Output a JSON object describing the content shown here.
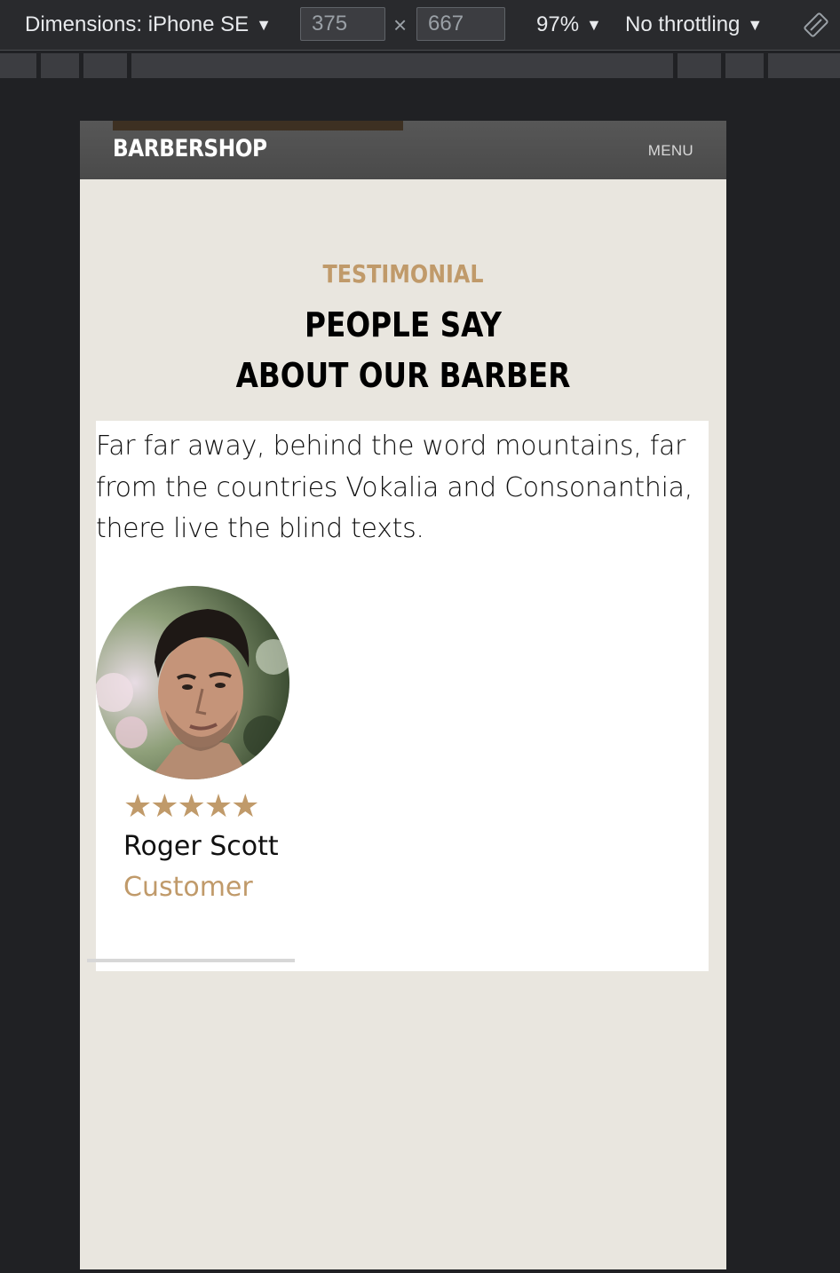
{
  "devtools": {
    "dimensions_label": "Dimensions: iPhone SE",
    "width_value": "375",
    "times": "×",
    "height_value": "667",
    "zoom": "97%",
    "throttling": "No throttling",
    "caret": "▼"
  },
  "site": {
    "brand": "BARBERSHOP",
    "menu_label": "MENU"
  },
  "testimonial": {
    "subheading": "TESTIMONIAL",
    "title_line1": "PEOPLE SAY",
    "title_line2": "ABOUT OUR BARBER",
    "quote": "Far far away, behind the word mountains, far from the countries Vokalia and Consonanthia, there live the blind texts.",
    "rating": 5,
    "stars": "★★★★★",
    "name": "Roger Scott",
    "role": "Customer"
  },
  "colors": {
    "accent": "#c09a6a",
    "page_bg": "#e9e6df",
    "navbar": "#4f4f4f",
    "devtools_bg": "#202124"
  }
}
